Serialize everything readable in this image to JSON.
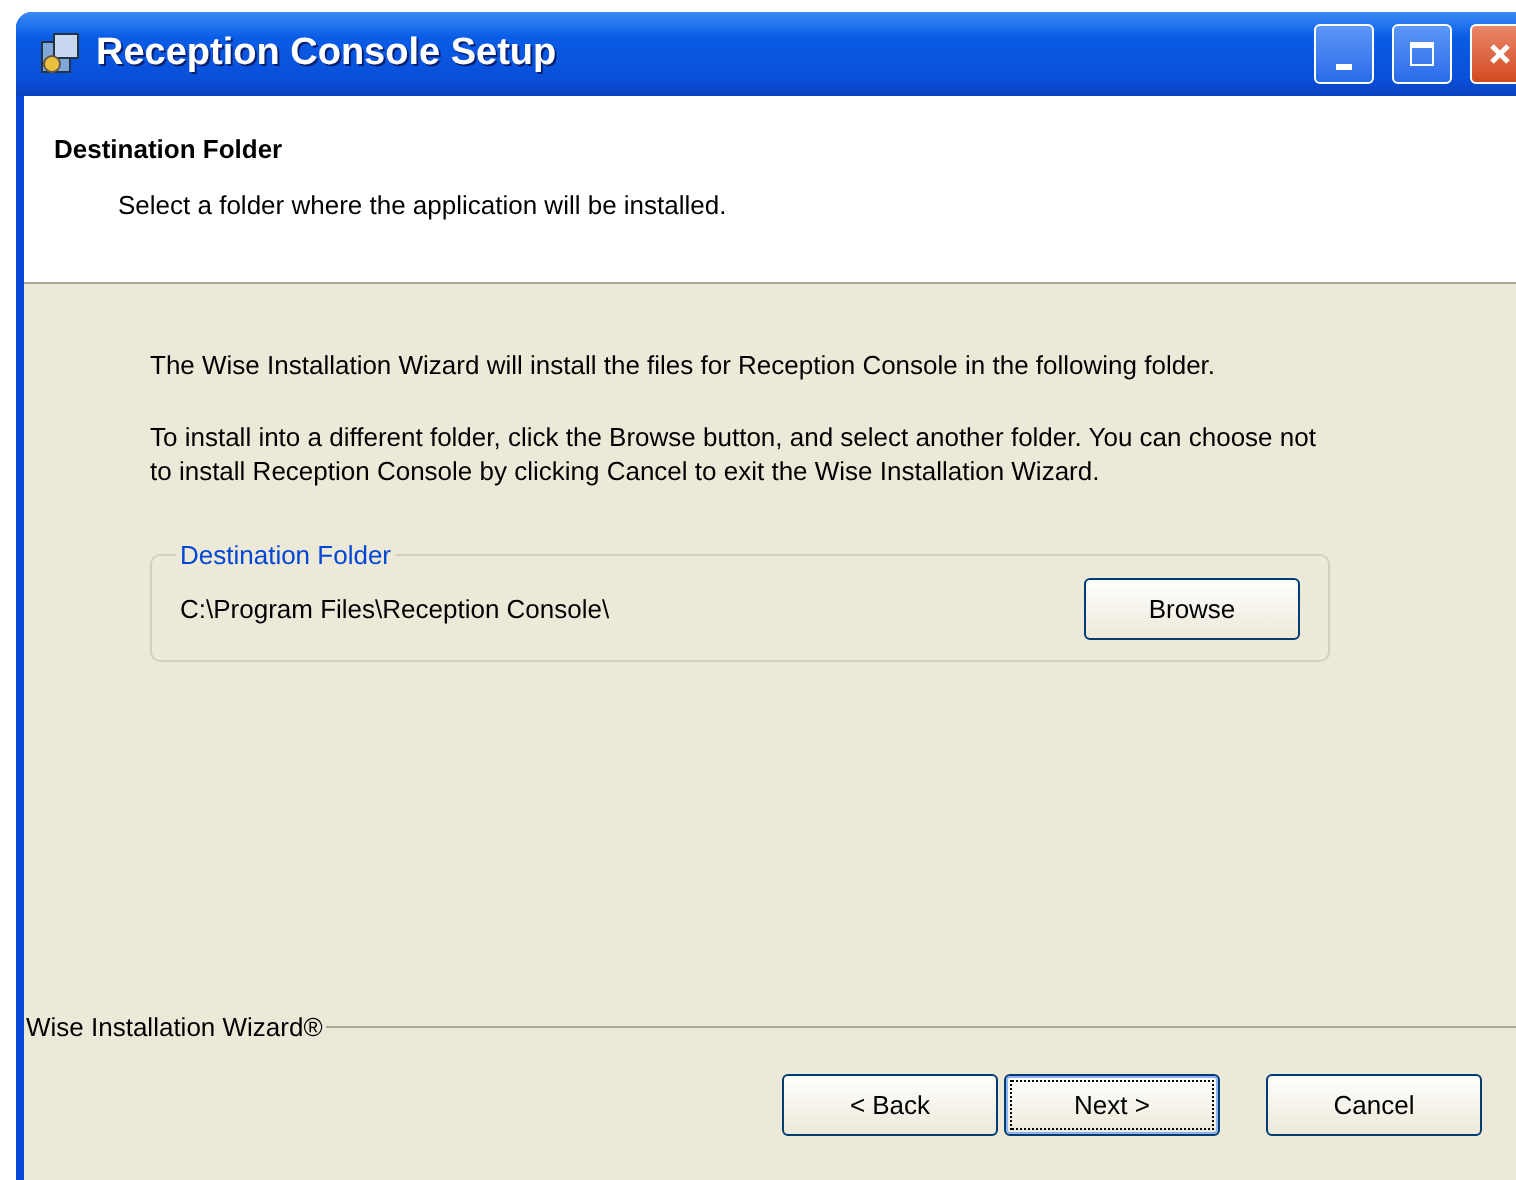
{
  "window": {
    "title": "Reception Console Setup"
  },
  "header": {
    "title": "Destination Folder",
    "subtitle": "Select a folder where the application will be installed."
  },
  "body": {
    "paragraphs": [
      "The Wise Installation Wizard will install the files for Reception Console in the following folder.",
      "To install into a different folder, click the Browse button, and select another folder. You can choose not to install Reception Console by clicking Cancel to exit the Wise Installation Wizard."
    ],
    "group": {
      "label": "Destination Folder",
      "path": "C:\\Program Files\\Reception Console\\",
      "button": "Browse"
    }
  },
  "footer": {
    "brand": "Wise Installation Wizard®",
    "buttons": [
      {
        "label": "< Back",
        "default": false
      },
      {
        "label": "Next >",
        "default": true
      },
      {
        "label": "Cancel",
        "default": false
      }
    ]
  }
}
